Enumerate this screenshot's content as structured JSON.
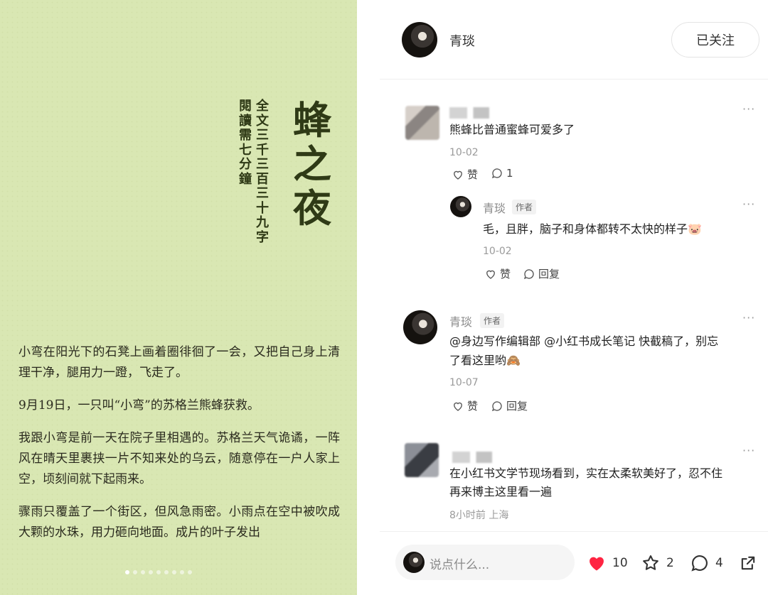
{
  "image": {
    "title": "蜂之夜",
    "subtitle_line1": "全文三千三百三十九字",
    "subtitle_line2": "閱讀需七分鐘",
    "paragraphs": [
      "小弯在阳光下的石凳上画着圈徘徊了一会，又把自己身上清理干净，腿用力一蹬，飞走了。",
      "9月19日，一只叫“小弯”的苏格兰熊蜂获救。",
      "我跟小弯是前一天在院子里相遇的。苏格兰天气诡谲，一阵风在晴天里裹挟一片不知来处的乌云，随意停在一户人家上空，顷刻间就下起雨来。",
      "骤雨只覆盖了一个街区，但风急雨密。小雨点在空中被吹成大颗的水珠，用力砸向地面。成片的叶子发出"
    ],
    "page_count": 9,
    "active_page": 1
  },
  "header": {
    "author_name": "青琰",
    "follow_label": "已关注"
  },
  "comments": [
    {
      "text": "熊蜂比普通蜜蜂可爱多了",
      "date": "10-02",
      "like_label": "赞",
      "reply_count": "1",
      "replies": [
        {
          "name": "青琰",
          "tag": "作者",
          "text": "毛，且胖，脑子和身体都转不太快的样子🐷",
          "date": "10-02",
          "like_label": "赞",
          "reply_label": "回复"
        }
      ]
    },
    {
      "name": "青琰",
      "tag": "作者",
      "text_line1": "@身边写作编辑部 @小红书成长笔记 快截稿了，别忘",
      "text_line2": "了看这里哟🙈",
      "date": "10-07",
      "like_label": "赞",
      "reply_label": "回复"
    },
    {
      "text_line1": "在小红书文学节现场看到，实在太柔软美好了，忍不住",
      "text_line2": "再来博主这里看一遍",
      "date": "8小时前 上海"
    }
  ],
  "bottom_bar": {
    "input_placeholder": "说点什么...",
    "likes": "10",
    "stars": "2",
    "comments": "4"
  },
  "colors": {
    "image_bg": "#d9e7b3",
    "like_red": "#ff2442",
    "ink": "#2f3a16"
  },
  "icons": [
    "heart-icon",
    "star-icon",
    "comment-icon",
    "share-icon",
    "more-icon"
  ]
}
